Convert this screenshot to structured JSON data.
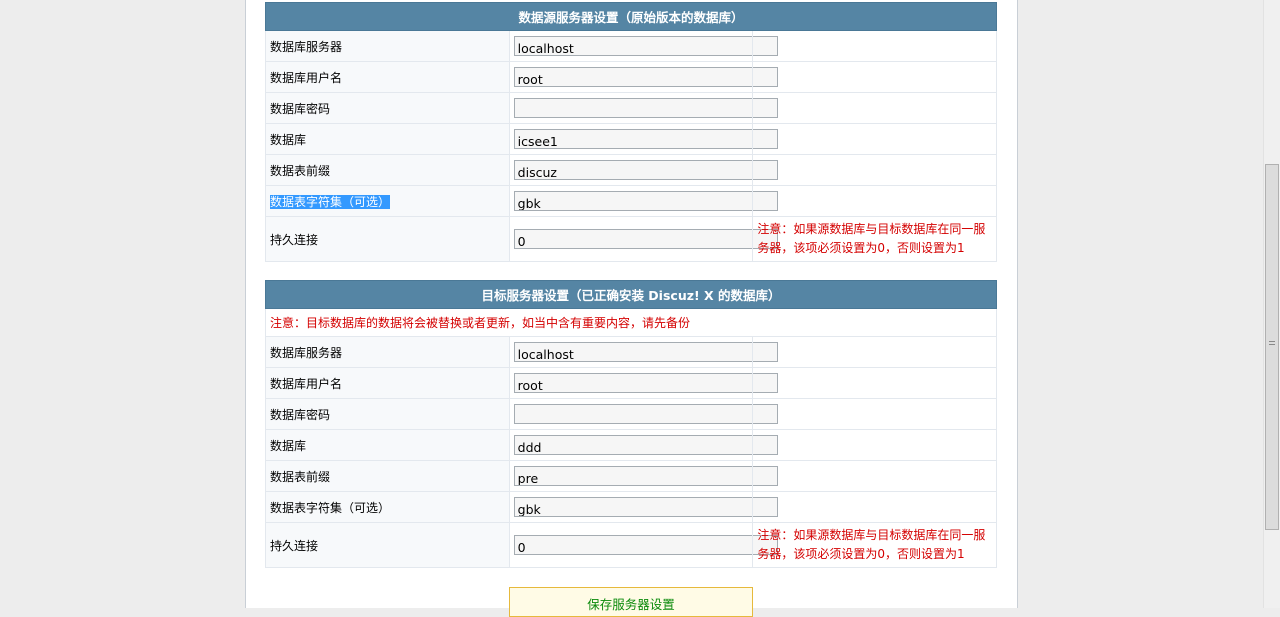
{
  "source": {
    "title": "数据源服务器设置（原始版本的数据库）",
    "rows": [
      {
        "label": "数据库服务器",
        "value": "localhost"
      },
      {
        "label": "数据库用户名",
        "value": "root"
      },
      {
        "label": "数据库密码",
        "value": ""
      },
      {
        "label": "数据库",
        "value": "icsee1"
      },
      {
        "label": "数据表前缀",
        "value": "discuz_"
      },
      {
        "label": "数据表字符集（可选）",
        "value": "gbk"
      },
      {
        "label": "持久连接",
        "value": "0",
        "note": "注意：如果源数据库与目标数据库在同一服务器，该项必须设置为0，否则设置为1"
      }
    ]
  },
  "target": {
    "title": "目标服务器设置（已正确安装 Discuz! X 的数据库）",
    "warning": "注意：目标数据库的数据将会被替换或者更新，如当中含有重要内容，请先备份",
    "rows": [
      {
        "label": "数据库服务器",
        "value": "localhost"
      },
      {
        "label": "数据库用户名",
        "value": "root"
      },
      {
        "label": "数据库密码",
        "value": ""
      },
      {
        "label": "数据库",
        "value": "ddd"
      },
      {
        "label": "数据表前缀",
        "value": "pre_"
      },
      {
        "label": "数据表字符集（可选）",
        "value": "gbk"
      },
      {
        "label": "持久连接",
        "value": "0",
        "note": "注意：如果源数据库与目标数据库在同一服务器，该项必须设置为0，否则设置为1"
      }
    ]
  },
  "save_label": "保存服务器设置",
  "colors": {
    "header_bg": "#5585a4",
    "note_red": "#d40000",
    "button_text": "#0a8a0a"
  }
}
